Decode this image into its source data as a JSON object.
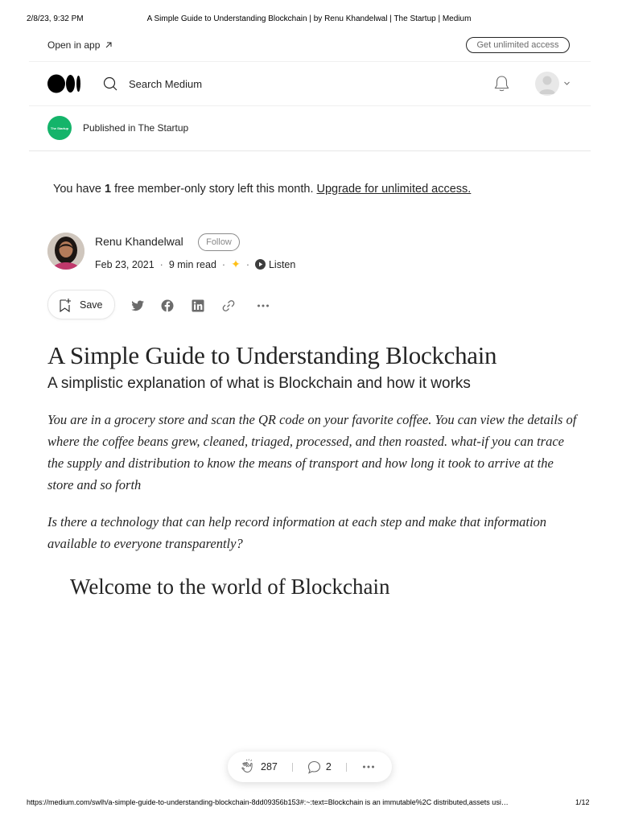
{
  "print": {
    "date": "2/8/23, 9:32 PM",
    "title": "A Simple Guide to Understanding Blockchain | by Renu Khandelwal | The Startup | Medium",
    "url": "https://medium.com/swlh/a-simple-guide-to-understanding-blockchain-8dd09356b153#:~:text=Blockchain is an immutable%2C distributed,assets usi…",
    "page": "1/12"
  },
  "topbar": {
    "open_in_app": "Open in app",
    "get_access": "Get unlimited access"
  },
  "header": {
    "search_placeholder": "Search Medium"
  },
  "publication": {
    "logo_text": "The Startup",
    "label": "Published in The Startup"
  },
  "member_note": {
    "prefix": "You have ",
    "count": "1",
    "middle": " free member-only story left this month. ",
    "link": "Upgrade for unlimited access."
  },
  "author": {
    "name": "Renu Khandelwal",
    "follow": "Follow",
    "date": "Feb 23, 2021",
    "read_time": "9 min read",
    "listen": "Listen"
  },
  "actions": {
    "save": "Save"
  },
  "article": {
    "title": "A Simple Guide to Understanding Blockchain",
    "subtitle": "A simplistic explanation of what is Blockchain and how it works",
    "paragraph1": "You are in a grocery store and scan the QR code on your favorite coffee. You can view the details of where the coffee beans grew, cleaned, triaged, processed, and then roasted. what-if you can trace the supply and distribution to know the means of transport and how long it took to arrive at the store and so forth",
    "paragraph2": "Is there a technology that can help record information at each step and make that information available to everyone transparently?",
    "heading": "Welcome to the world of Blockchain"
  },
  "floating_bar": {
    "claps": "287",
    "responses": "2"
  },
  "colors": {
    "accent_green": "#14b46a",
    "star": "#ffc017",
    "text": "#242424"
  }
}
